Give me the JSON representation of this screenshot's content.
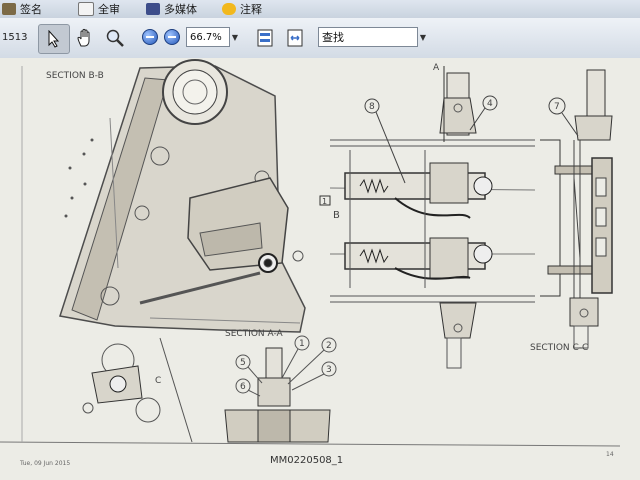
{
  "menu": {
    "items": [
      {
        "label": "签名"
      },
      {
        "label": "全审"
      },
      {
        "label": "多媒体"
      },
      {
        "label": "注释"
      }
    ]
  },
  "toolbar": {
    "page_number": "1513",
    "zoom_value": "66.7%",
    "search_value": "查找",
    "icons": [
      "select-arrow-icon",
      "hand-icon",
      "zoom-tool-icon",
      "zoom-out-icon",
      "zoom-in-icon",
      "fit-page-icon",
      "fit-width-icon"
    ]
  },
  "drawing": {
    "section_bb": "SECTION  B-B",
    "section_aa": "SECTION   A-A",
    "section_cc": "SECTION   C-C",
    "marker_a": "A",
    "marker_b": "B",
    "marker_one": "1",
    "marker_c": "C",
    "callouts": [
      "1",
      "2",
      "3",
      "4",
      "5",
      "6",
      "7",
      "8"
    ],
    "drawing_number": "MM0220508_1",
    "date": "Tue, 09 Jun 2015",
    "page_code": "14"
  }
}
